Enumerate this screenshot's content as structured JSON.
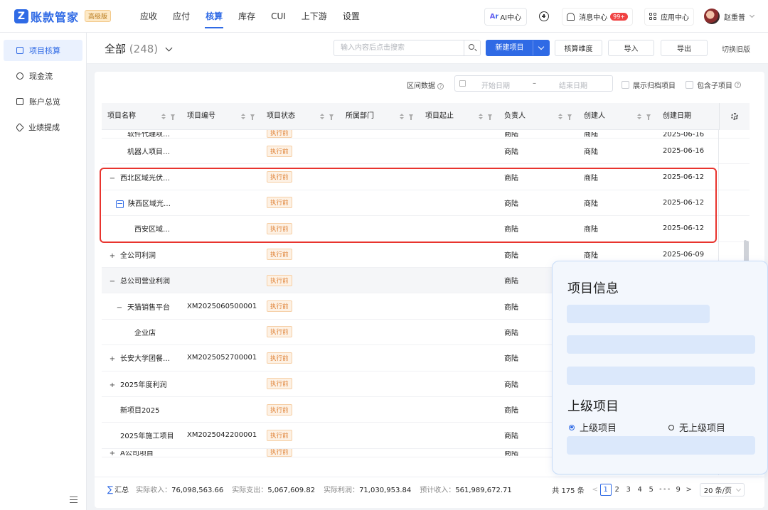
{
  "app": {
    "logo_mark": "Z",
    "name": "账款管家",
    "edition": "高级版",
    "nav": [
      "应收",
      "应付",
      "核算",
      "库存",
      "CUI",
      "上下游",
      "设置"
    ],
    "active_nav": "核算",
    "ai_label": "AI中心",
    "ai_mark": "Ar",
    "messages_label": "消息中心",
    "messages_badge": "99+",
    "app_center_label": "应用中心",
    "user_name": "赵重普"
  },
  "sidebar": {
    "items": [
      {
        "label": "项目核算",
        "icon": "document-icon",
        "active": true
      },
      {
        "label": "现金流",
        "icon": "cash-icon",
        "active": false
      },
      {
        "label": "账户总览",
        "icon": "wallet-icon",
        "active": false
      },
      {
        "label": "业绩提成",
        "icon": "tag-icon",
        "active": false
      }
    ]
  },
  "header": {
    "title": "全部",
    "count": "(248)",
    "search_placeholder": "输入内容后点击搜索",
    "new_project": "新建项目",
    "dimension": "核算维度",
    "import": "导入",
    "export": "导出",
    "switch_old": "切换旧版"
  },
  "filters": {
    "range_label": "区间数据",
    "help_glyph": "?",
    "start_date_placeholder": "开始日期",
    "separator": "–",
    "end_date_placeholder": "结束日期",
    "show_archived": "展示归档项目",
    "include_children": "包含子项目"
  },
  "table": {
    "columns": [
      "项目名称",
      "项目编号",
      "项目状态",
      "所属部门",
      "项目起止",
      "负责人",
      "创建人",
      "创建日期"
    ],
    "rows": [
      {
        "name": "软件代理项…",
        "code": "",
        "status": "执行前",
        "dept": "",
        "period": "",
        "owner": "商陆",
        "creator": "商陆",
        "date": "2025-06-16",
        "level": 1,
        "expander": "",
        "cut": true
      },
      {
        "name": "机器人项目…",
        "code": "",
        "status": "执行前",
        "dept": "",
        "period": "",
        "owner": "商陆",
        "creator": "商陆",
        "date": "2025-06-16",
        "level": 1,
        "expander": ""
      },
      {
        "name": "西北区域光伏…",
        "code": "",
        "status": "执行前",
        "dept": "",
        "period": "",
        "owner": "商陆",
        "creator": "商陆",
        "date": "2025-06-12",
        "level": 0,
        "expander": "−"
      },
      {
        "name": "陕西区域光…",
        "code": "",
        "status": "执行前",
        "dept": "",
        "period": "",
        "owner": "商陆",
        "creator": "商陆",
        "date": "2025-06-12",
        "level": 1,
        "expander": "−",
        "boxed": true
      },
      {
        "name": "西安区域…",
        "code": "",
        "status": "执行前",
        "dept": "",
        "period": "",
        "owner": "商陆",
        "creator": "商陆",
        "date": "2025-06-12",
        "level": 2,
        "expander": ""
      },
      {
        "name": "全公司利润",
        "code": "",
        "status": "执行前",
        "dept": "",
        "period": "",
        "owner": "商陆",
        "creator": "商陆",
        "date": "2025-06-09",
        "level": 0,
        "expander": "+"
      },
      {
        "name": "总公司营业利润",
        "code": "",
        "status": "执行前",
        "dept": "",
        "period": "",
        "owner": "商陆",
        "creator": "",
        "date": "",
        "level": 0,
        "expander": "−",
        "alt": true
      },
      {
        "name": "天猫销售平台",
        "code": "XM2025060500001",
        "status": "执行前",
        "dept": "",
        "period": "",
        "owner": "商陆",
        "creator": "",
        "date": "",
        "level": 1,
        "expander": "−"
      },
      {
        "name": "企业店",
        "code": "",
        "status": "执行前",
        "dept": "",
        "period": "",
        "owner": "商陆",
        "creator": "",
        "date": "",
        "level": 2,
        "expander": ""
      },
      {
        "name": "长安大学团餐…",
        "code": "XM2025052700001",
        "status": "执行前",
        "dept": "",
        "period": "",
        "owner": "商陆",
        "creator": "",
        "date": "",
        "level": 0,
        "expander": "+"
      },
      {
        "name": "2025年度利润",
        "code": "",
        "status": "执行前",
        "dept": "",
        "period": "",
        "owner": "商陆",
        "creator": "",
        "date": "",
        "level": 0,
        "expander": "+"
      },
      {
        "name": "新项目2025",
        "code": "",
        "status": "执行前",
        "dept": "",
        "period": "",
        "owner": "商陆",
        "creator": "",
        "date": "",
        "level": 0,
        "expander": ""
      },
      {
        "name": "2025年施工项目",
        "code": "XM2025042200001",
        "status": "执行前",
        "dept": "",
        "period": "",
        "owner": "商陆",
        "creator": "",
        "date": "",
        "level": 0,
        "expander": ""
      },
      {
        "name": "A公司项目",
        "code": "",
        "status": "执行前",
        "dept": "",
        "period": "",
        "owner": "商陆",
        "creator": "",
        "date": "",
        "level": 0,
        "expander": "+",
        "cut": true
      }
    ]
  },
  "summary": {
    "icon_glyph": "∑",
    "title": "汇总",
    "items": [
      {
        "label": "实际收入：",
        "value": "76,098,563.66"
      },
      {
        "label": "实际支出：",
        "value": "5,067,609.82"
      },
      {
        "label": "实际利润：",
        "value": "71,030,953.84"
      },
      {
        "label": "预计收入：",
        "value": "561,989,672.71"
      }
    ]
  },
  "pagination": {
    "total": "共 175 条",
    "prev": "<",
    "next": ">",
    "pages": [
      "1",
      "2",
      "3",
      "4",
      "5",
      "•••",
      "9"
    ],
    "current": "1",
    "page_size": "20 条/页"
  },
  "info_panel": {
    "title": "项目信息",
    "parent_title": "上级项目",
    "option_has_parent": "上级项目",
    "option_no_parent": "无上级项目",
    "selected": "上级项目"
  },
  "colors": {
    "accent": "#2f6ae5",
    "highlight": "#e8342e",
    "status_tag": "#e0853b"
  }
}
